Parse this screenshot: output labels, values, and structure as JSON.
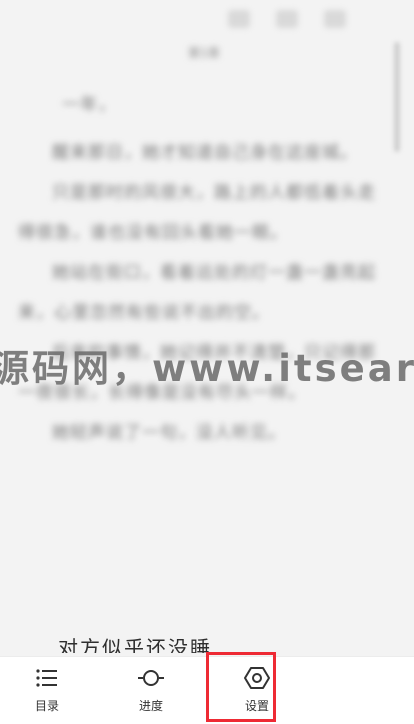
{
  "reader": {
    "chapter_title": "第1章",
    "opening": "一年，",
    "paragraphs": [
      "醒来那日，她才知道自己身在这座城。",
      "只是那时的风很大，路上的人都低着头走得很急，谁也没有回头看她一眼。",
      "她站在街口，看着远处的灯一盏一盏亮起来，心里忽然有些说不出的空。",
      "后来的事情，她记得并不清楚，只记得那一夜很长，长得像是没有尽头一样。",
      "她轻声说了一句，没人听见。"
    ],
    "last_line": "对方似乎还没睡"
  },
  "watermark": "源码网，www.itsear.",
  "toolbar": {
    "toc_label": "目录",
    "progress_label": "进度",
    "settings_label": "设置"
  },
  "colors": {
    "highlight": "#ee2a34",
    "toolbar_bg": "#ffffff"
  }
}
